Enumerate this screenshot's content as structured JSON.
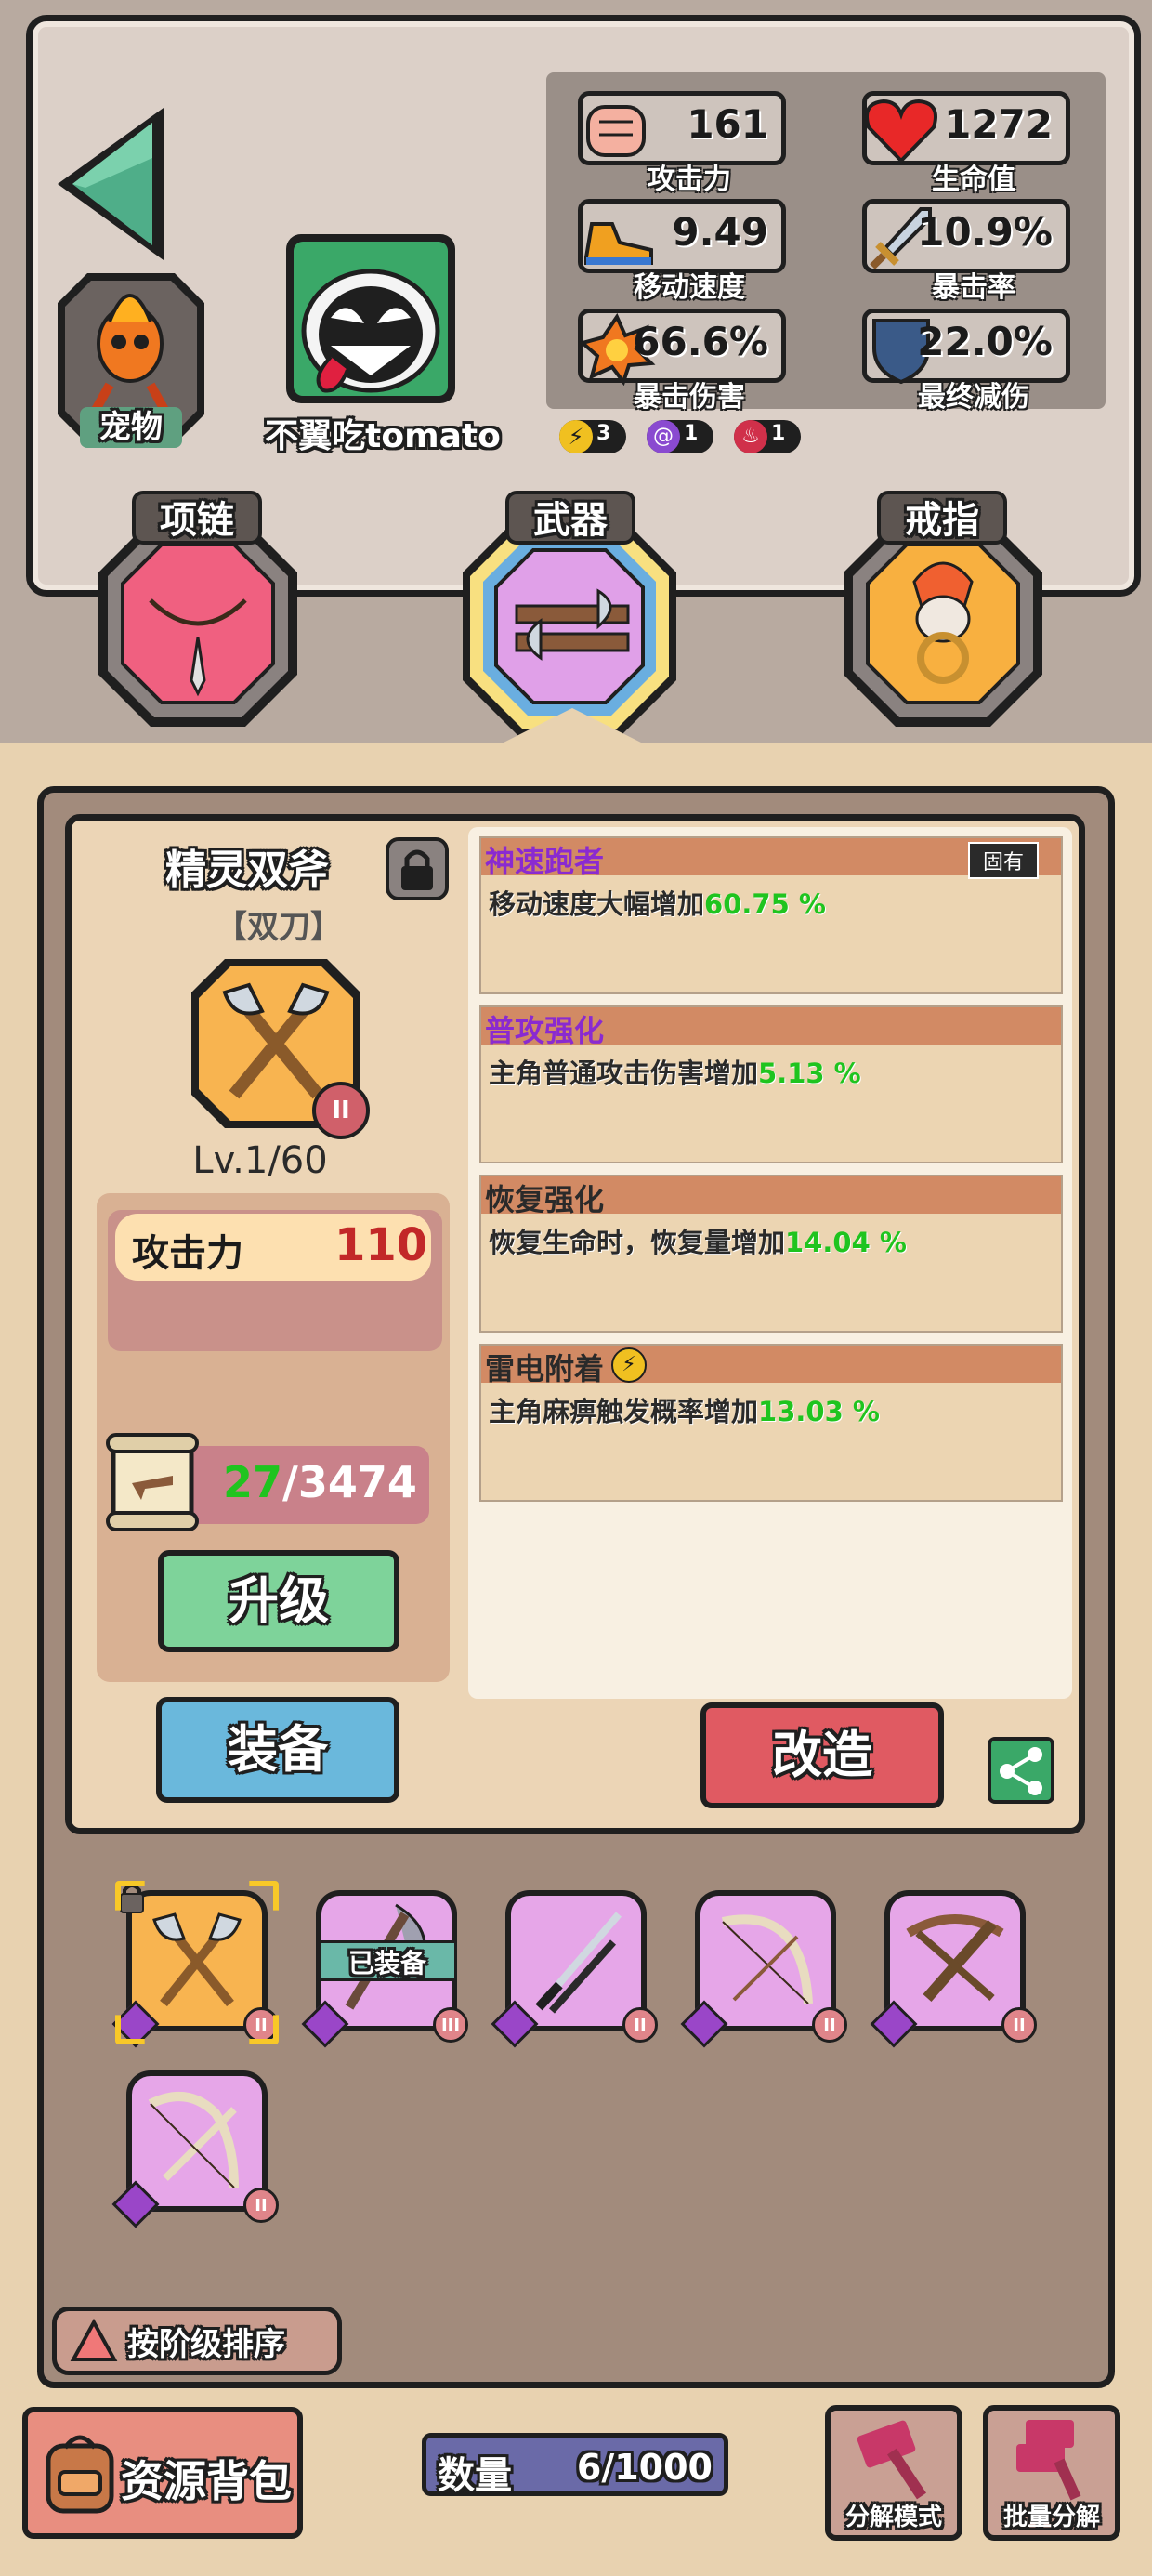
{
  "player": {
    "name": "不翼吃tomato",
    "pet_label": "宠物"
  },
  "stats": [
    {
      "key": "attack",
      "value": "161",
      "label": "攻击力",
      "icon": "fist-icon"
    },
    {
      "key": "hp",
      "value": "1272",
      "label": "生命值",
      "icon": "heart-icon"
    },
    {
      "key": "move_speed",
      "value": "9.49",
      "label": "移动速度",
      "icon": "shoe-icon"
    },
    {
      "key": "crit_rate",
      "value": "10.9%",
      "label": "暴击率",
      "icon": "sword-icon"
    },
    {
      "key": "crit_damage",
      "value": "66.6%",
      "label": "暴击伤害",
      "icon": "explosion-icon"
    },
    {
      "key": "damage_reduction",
      "value": "22.0%",
      "label": "最终减伤",
      "icon": "shield-icon"
    }
  ],
  "elements": [
    {
      "icon": "lightning-icon",
      "count": "3",
      "color": "#f0c020"
    },
    {
      "icon": "vortex-icon",
      "count": "1",
      "color": "#8a4ad0"
    },
    {
      "icon": "fire-icon",
      "count": "1",
      "color": "#d0304a"
    }
  ],
  "slots": {
    "necklace": "项链",
    "weapon": "武器",
    "ring": "戒指"
  },
  "weapon": {
    "name": "精灵双斧",
    "type": "【双刀】",
    "tier": "II",
    "level": "Lv.1/60",
    "attack_label": "攻击力",
    "attack_value": "110",
    "scroll_have": "27",
    "scroll_need": "/3474",
    "upgrade_label": "升级",
    "equip_label": "装备",
    "reforge_label": "改造"
  },
  "affixes": [
    {
      "name": "神速跑者",
      "tag": "固有",
      "desc_prefix": "移动速度大幅增加",
      "desc_value": "60.75 %"
    },
    {
      "name": "普攻强化",
      "tag": "",
      "desc_prefix": "主角普通攻击伤害增加",
      "desc_value": "5.13 %"
    },
    {
      "name": "恢复强化",
      "tag": "",
      "desc_prefix": "恢复生命时，恢复量增加",
      "desc_value": "14.04 %"
    },
    {
      "name": "雷电附着",
      "tag": "",
      "desc_prefix": "主角麻痹触发概率增加",
      "desc_value": "13.03 %"
    }
  ],
  "inventory": {
    "equipped_label": "已装备",
    "items": [
      {
        "name": "twin-axe",
        "tier": "II"
      },
      {
        "name": "battle-axe",
        "tier": "III"
      },
      {
        "name": "katana",
        "tier": "II"
      },
      {
        "name": "bone-bow",
        "tier": "II"
      },
      {
        "name": "crossbow",
        "tier": "II"
      },
      {
        "name": "bone-crossbow",
        "tier": "II"
      }
    ],
    "sort_label": "按阶级排序"
  },
  "footer": {
    "resource_bag_label": "资源背包",
    "count_label": "数量",
    "count_value": "6/1000",
    "decompose_mode_label": "分解模式",
    "batch_decompose_label": "批量分解"
  },
  "colors": {
    "accent_green": "#1fc41f",
    "attack_red": "#c22828",
    "affix_purple": "#8a2ad0"
  }
}
